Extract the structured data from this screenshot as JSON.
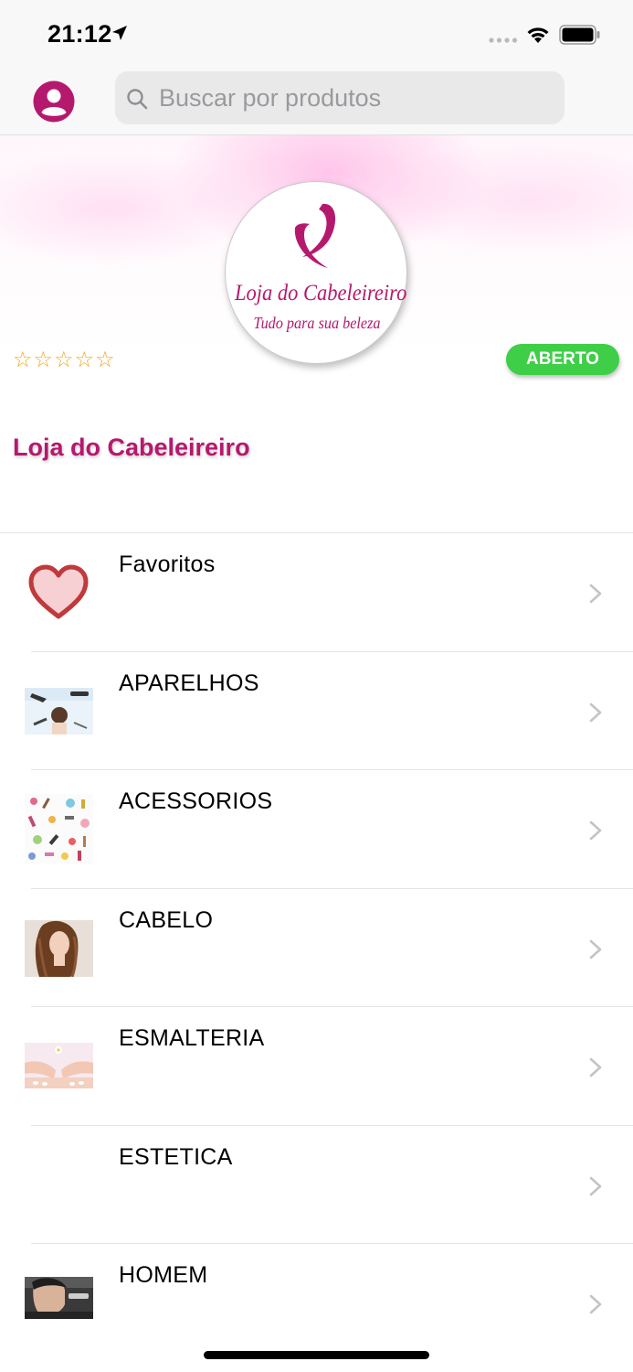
{
  "status_bar": {
    "time": "21:12"
  },
  "search": {
    "placeholder": "Buscar por produtos"
  },
  "store": {
    "logo_name": "Loja do Cabeleireiro",
    "logo_tagline": "Tudo para sua beleza",
    "rating_stars": "☆☆☆☆☆",
    "rating_value": 0,
    "status": "ABERTO",
    "name": "Loja do Cabeleireiro"
  },
  "categories": [
    {
      "label": "Favoritos",
      "icon": "heart-icon"
    },
    {
      "label": "APARELHOS",
      "icon": "aparelhos-thumbnail"
    },
    {
      "label": "ACESSORIOS",
      "icon": "acessorios-thumbnail"
    },
    {
      "label": "CABELO",
      "icon": "cabelo-thumbnail"
    },
    {
      "label": "ESMALTERIA",
      "icon": "esmalteria-thumbnail"
    },
    {
      "label": "ESTETICA",
      "icon": ""
    },
    {
      "label": "HOMEM",
      "icon": "homem-thumbnail"
    }
  ],
  "colors": {
    "brand": "#b5196e",
    "open_badge": "#3fce48",
    "star": "#f0a820",
    "heart_outline": "#c0393b",
    "heart_fill": "#f6d0d3"
  }
}
